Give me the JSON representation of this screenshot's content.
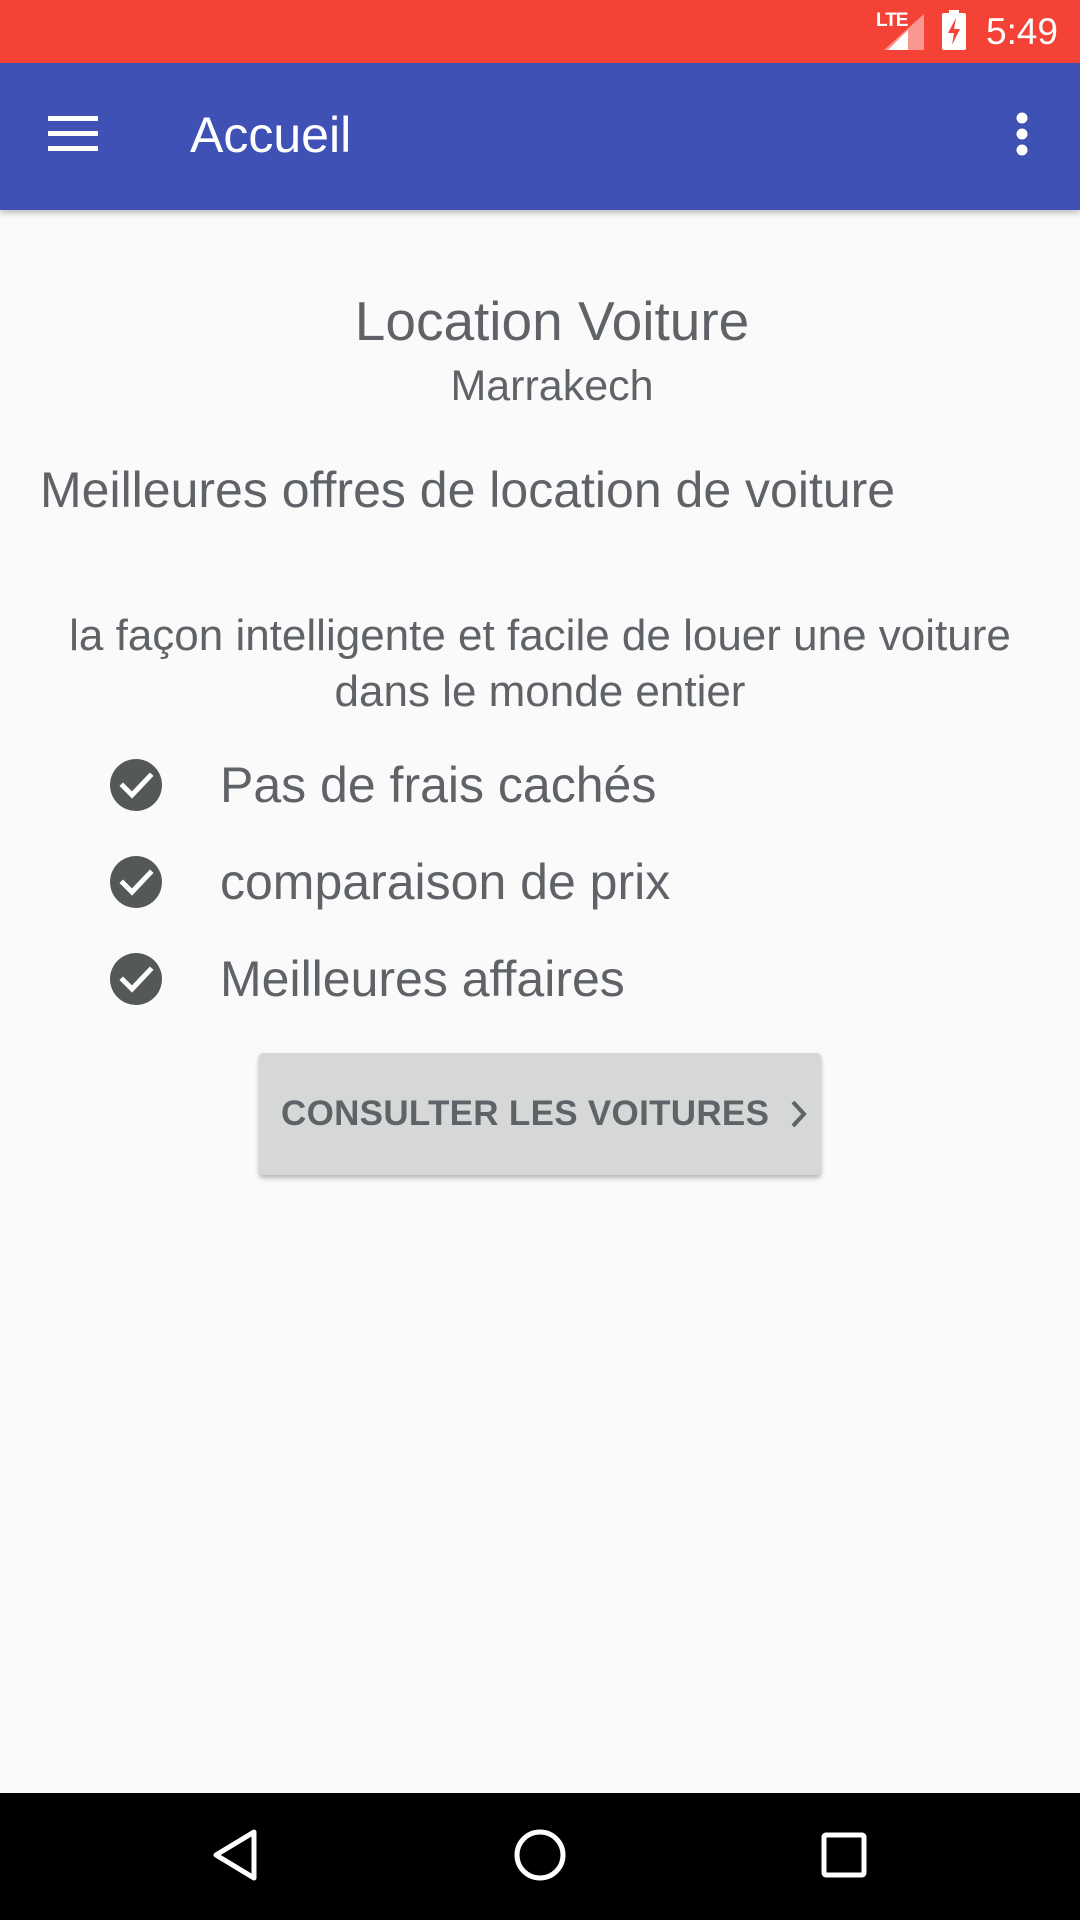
{
  "status_bar": {
    "network": "LTE",
    "time": "5:49",
    "color": "#f44336"
  },
  "app_bar": {
    "title": "Accueil",
    "color": "#3f51b5",
    "menu_icon": "hamburger-menu-icon",
    "more_icon": "more-vertical-icon"
  },
  "content": {
    "brand_title": "Location Voiture",
    "brand_city": "Marrakech",
    "headline": "Meilleures offres de location de voiture",
    "tagline": "la façon intelligente et facile de louer une voiture dans le monde entier",
    "features": [
      {
        "label": "Pas de frais cachés",
        "icon": "check-circle-icon"
      },
      {
        "label": "comparaison de prix",
        "icon": "check-circle-icon"
      },
      {
        "label": "Meilleures affaires",
        "icon": "check-circle-icon"
      }
    ],
    "cta_label": "CONSULTER LES VOITURES",
    "cta_icon": "chevron-right-icon"
  },
  "nav_bar": {
    "back_icon": "back-triangle-icon",
    "home_icon": "home-circle-icon",
    "recents_icon": "recents-square-icon"
  }
}
